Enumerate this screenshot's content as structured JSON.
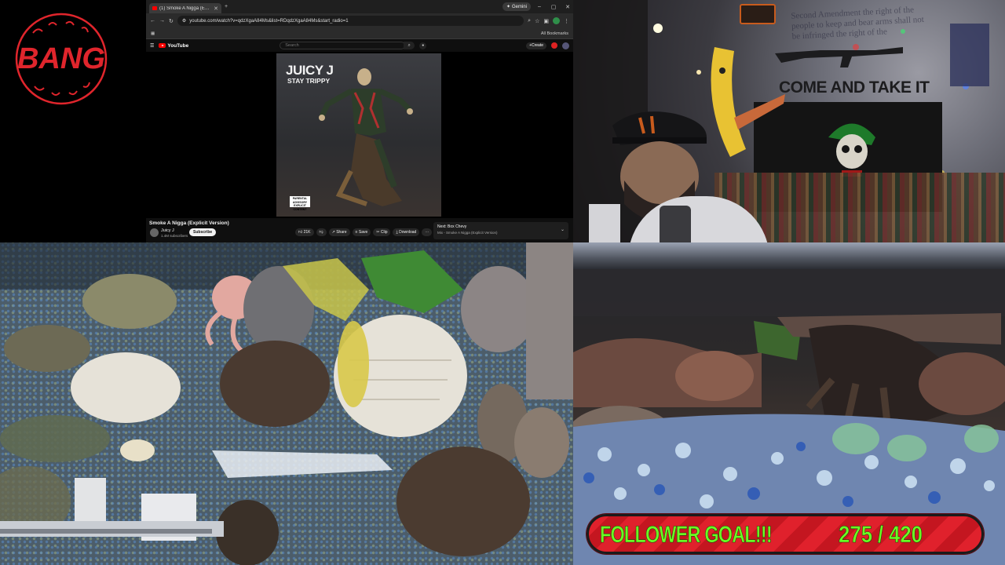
{
  "logo": {
    "text": "BANG",
    "color": "#e0252c"
  },
  "browser": {
    "tab": {
      "title": "(1) Smoke A Nigga (Explicit"
    },
    "gemini_label": "Gemini",
    "url": "youtube.com/watch?v=qdzXgaA84Ms&list=RDqdzXgaA84Ms&start_radio=1",
    "bookmarks_label": "All Bookmarks"
  },
  "youtube": {
    "logo_text": "YouTube",
    "search_placeholder": "Search",
    "create_label": "Create",
    "album": {
      "artist": "JUICY J",
      "title": "STAY TRIPPY",
      "advisory": "PARENTAL ADVISORY EXPLICIT CONTENT"
    },
    "video_title": "Smoke A Nigga (Explicit Version)",
    "channel_name": "Juicy J",
    "channel_subs": "1.4M subscribers",
    "subscribe_label": "Subscribe",
    "actions": {
      "like": "21K",
      "share": "Share",
      "save": "Save",
      "clip": "Clip",
      "download": "Download"
    },
    "next_label": "Next: Box Chevy",
    "next_mix": "Mix - Smoke A Nigga (Explicit Version)"
  },
  "webcam": {
    "poster_text": "Second Amendment the right of the people to keep and bear arms shall not be infringed the right of the",
    "flag_text": "COME AND TAKE IT"
  },
  "goal": {
    "label": "FOLLOWER GOAL!!!",
    "current": "275",
    "separator": "/",
    "target": "420",
    "progress": 0.655,
    "text_color": "#6bff24",
    "bar_color": "#e0212c"
  }
}
